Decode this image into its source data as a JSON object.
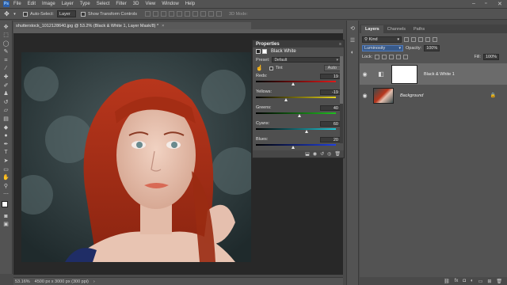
{
  "menu": {
    "logo": "Ps",
    "items": [
      "File",
      "Edit",
      "Image",
      "Layer",
      "Type",
      "Select",
      "Filter",
      "3D",
      "View",
      "Window",
      "Help"
    ],
    "window_controls": {
      "minimize": "–",
      "restore": "▫",
      "close": "✕"
    }
  },
  "options": {
    "auto_select_label": "Auto-Select:",
    "auto_select_value": "Layer",
    "transform_label": "Show Transform Controls",
    "mode_3d": "3D Mode:"
  },
  "document": {
    "tab_title": "shutterstock_1012128640.jpg @ 53.2% (Black & White 1, Layer Mask/8) *",
    "close": "×"
  },
  "status": {
    "zoom": "53.16%",
    "doc_info": "4500 px x 3000 px (300 ppi)"
  },
  "properties": {
    "title": "Properties",
    "adjustment_name": "Black  White",
    "preset_label": "Preset:",
    "preset_value": "Default",
    "tint_label": "Tint",
    "auto_label": "Auto",
    "sliders": [
      {
        "name": "Reds:",
        "value": "19",
        "fraction": 0.44,
        "gradient": "linear-gradient(to right,#000,#e01818)"
      },
      {
        "name": "Yellows:",
        "value": "-19",
        "fraction": 0.36,
        "gradient": "linear-gradient(to right,#000,#e6d31a)"
      },
      {
        "name": "Greens:",
        "value": "40",
        "fraction": 0.52,
        "gradient": "linear-gradient(to right,#000,#20c020)"
      },
      {
        "name": "Cyans:",
        "value": "60",
        "fraction": 0.6,
        "gradient": "linear-gradient(to right,#000,#20c8d8)"
      },
      {
        "name": "Blues:",
        "value": "20",
        "fraction": 0.44,
        "gradient": "linear-gradient(to right,#000,#2040e0)"
      }
    ]
  },
  "layers": {
    "tabs": [
      "Layers",
      "Channels",
      "Paths"
    ],
    "kind_label": "Kind",
    "blend_mode": "Luminosity",
    "opacity_label": "Opacity:",
    "opacity_value": "100%",
    "lock_label": "Lock:",
    "fill_label": "Fill:",
    "fill_value": "100%",
    "items": [
      {
        "name": "Black & White 1",
        "selected": true
      },
      {
        "name": "Background",
        "selected": false
      }
    ]
  }
}
